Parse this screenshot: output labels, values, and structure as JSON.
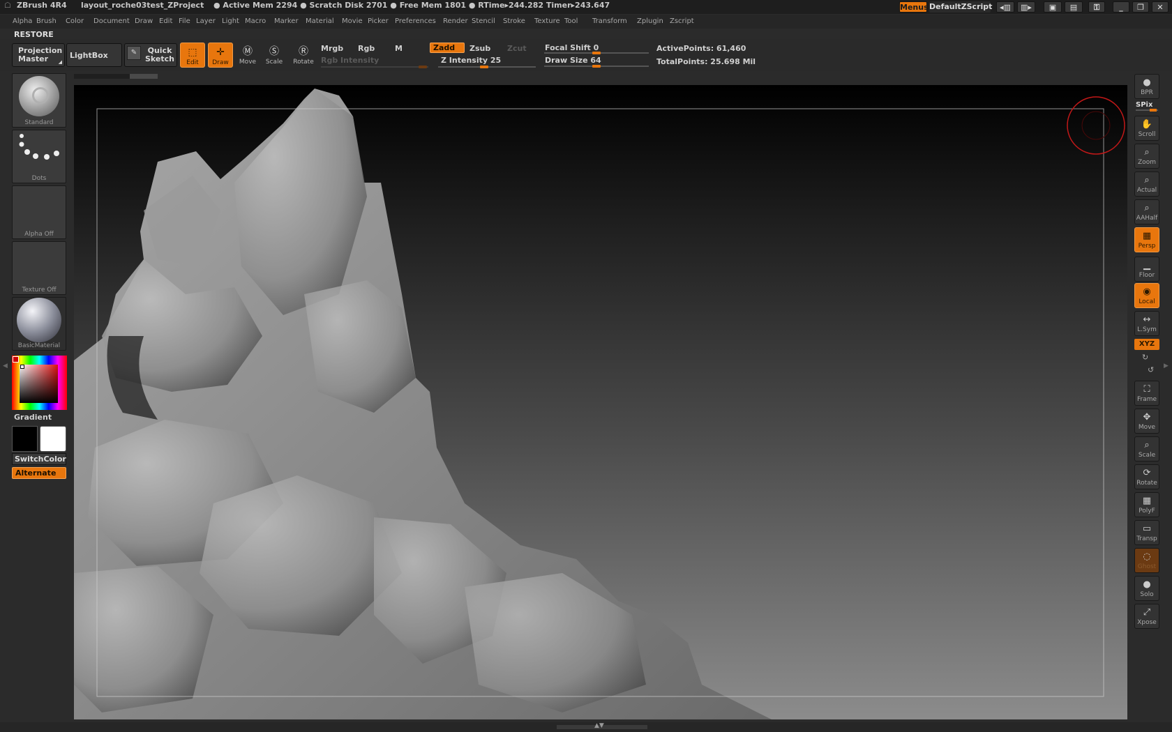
{
  "titlebar": {
    "app": "ZBrush 4R4",
    "project": "layout_roche03test_ZProject",
    "stats": "● Active Mem 2294 ● Scratch Disk 2701 ● Free Mem 1801 ● RTime▸244.282 Timer▸243.647",
    "menus_btn": "Menus",
    "script_btn": "DefaultZScript"
  },
  "menubar": [
    "Alpha",
    "Brush",
    "Color",
    "Document",
    "Draw",
    "Edit",
    "File",
    "Layer",
    "Light",
    "Macro",
    "Marker",
    "Material",
    "Movie",
    "Picker",
    "Preferences",
    "Render",
    "Stencil",
    "Stroke",
    "Texture",
    "Tool",
    "Transform",
    "Zplugin",
    "Zscript"
  ],
  "restore": "RESTORE",
  "shelf": {
    "projection_master": "Projection Master",
    "lightbox": "LightBox",
    "quick_sketch": "Quick Sketch",
    "edit": "Edit",
    "draw": "Draw",
    "move": "Move",
    "scale": "Scale",
    "rotate": "Rotate",
    "mrgb": "Mrgb",
    "rgb": "Rgb",
    "m": "M",
    "rgb_intensity": "Rgb Intensity",
    "zadd": "Zadd",
    "zsub": "Zsub",
    "zcut": "Zcut",
    "z_intensity": "Z Intensity 25",
    "focal_shift": "Focal Shift 0",
    "draw_size": "Draw Size 64",
    "active_points": "ActivePoints: 61,460",
    "total_points": "TotalPoints: 25.698 Mil"
  },
  "left_tray": {
    "brush": "Standard",
    "stroke": "Dots",
    "alpha": "Alpha Off",
    "texture": "Texture Off",
    "material": "BasicMaterial",
    "gradient": "Gradient",
    "switch_color": "SwitchColor",
    "alternate": "Alternate"
  },
  "right_tray": [
    {
      "label": "BPR",
      "icon": "bpr-icon",
      "state": "normal"
    },
    {
      "label": "Scroll",
      "icon": "hand-icon",
      "state": "normal"
    },
    {
      "label": "Zoom",
      "icon": "zoom-icon",
      "state": "normal"
    },
    {
      "label": "Actual",
      "icon": "actual-icon",
      "state": "normal"
    },
    {
      "label": "AAHalf",
      "icon": "aahalf-icon",
      "state": "normal"
    },
    {
      "label": "Persp",
      "icon": "perspective-icon",
      "state": "on"
    },
    {
      "label": "Floor",
      "icon": "floor-icon",
      "state": "normal"
    },
    {
      "label": "Local",
      "icon": "local-icon",
      "state": "on"
    },
    {
      "label": "L.Sym",
      "icon": "symmetry-icon",
      "state": "normal"
    },
    {
      "label": "Frame",
      "icon": "frame-icon",
      "state": "normal"
    },
    {
      "label": "Move",
      "icon": "move-icon",
      "state": "normal"
    },
    {
      "label": "Scale",
      "icon": "scale-icon",
      "state": "normal"
    },
    {
      "label": "Rotate",
      "icon": "rotate-icon",
      "state": "normal"
    },
    {
      "label": "PolyF",
      "icon": "polyframe-icon",
      "state": "normal"
    },
    {
      "label": "Transp",
      "icon": "transparency-icon",
      "state": "normal"
    },
    {
      "label": "Ghost",
      "icon": "ghost-icon",
      "state": "dim"
    },
    {
      "label": "Solo",
      "icon": "solo-icon",
      "state": "normal"
    },
    {
      "label": "Xpose",
      "icon": "xpose-icon",
      "state": "normal"
    }
  ],
  "spix_label": "SPix",
  "xyz_label": "XYZ",
  "colors": {
    "accent": "#e8760d",
    "bg": "#2b2b2b",
    "canvas_top": "#000000",
    "canvas_bottom": "#8c8c8c"
  }
}
